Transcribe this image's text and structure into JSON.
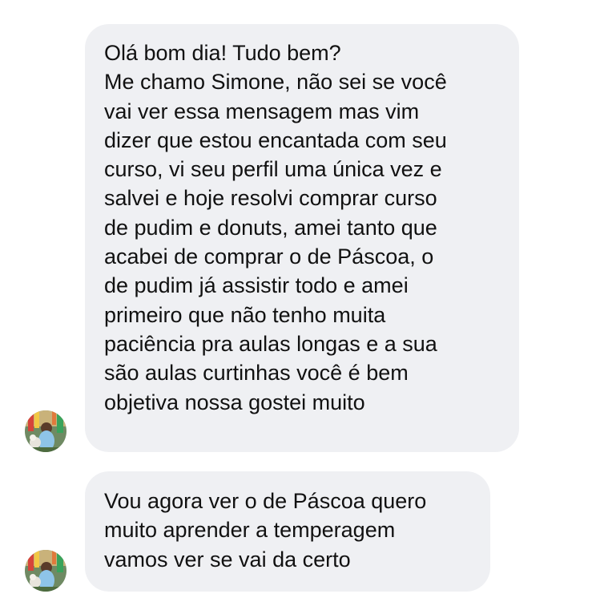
{
  "messages": [
    {
      "sender_avatar": "contact-avatar",
      "lines": [
        "Olá bom dia! Tudo bem?",
        "Me chamo Simone, não sei se você",
        "vai ver essa mensagem mas vim",
        "dizer que estou encantada com seu",
        "curso, vi seu perfil uma única vez e",
        "salvei e hoje resolvi comprar curso",
        "de pudim e donuts, amei tanto que",
        "acabei de comprar o de Páscoa, o",
        "de pudim já assistir todo e amei",
        "primeiro que não tenho muita",
        "paciência pra aulas longas e a sua",
        "são aulas curtinhas você é bem",
        "objetiva nossa gostei muito"
      ]
    },
    {
      "sender_avatar": "contact-avatar",
      "lines": [
        "Vou agora ver o de Páscoa quero",
        "muito aprender a temperagem",
        "vamos ver se vai da certo"
      ]
    }
  ],
  "colors": {
    "bubble_background": "#eff0f3",
    "text": "#111111",
    "page_background": "#ffffff"
  }
}
